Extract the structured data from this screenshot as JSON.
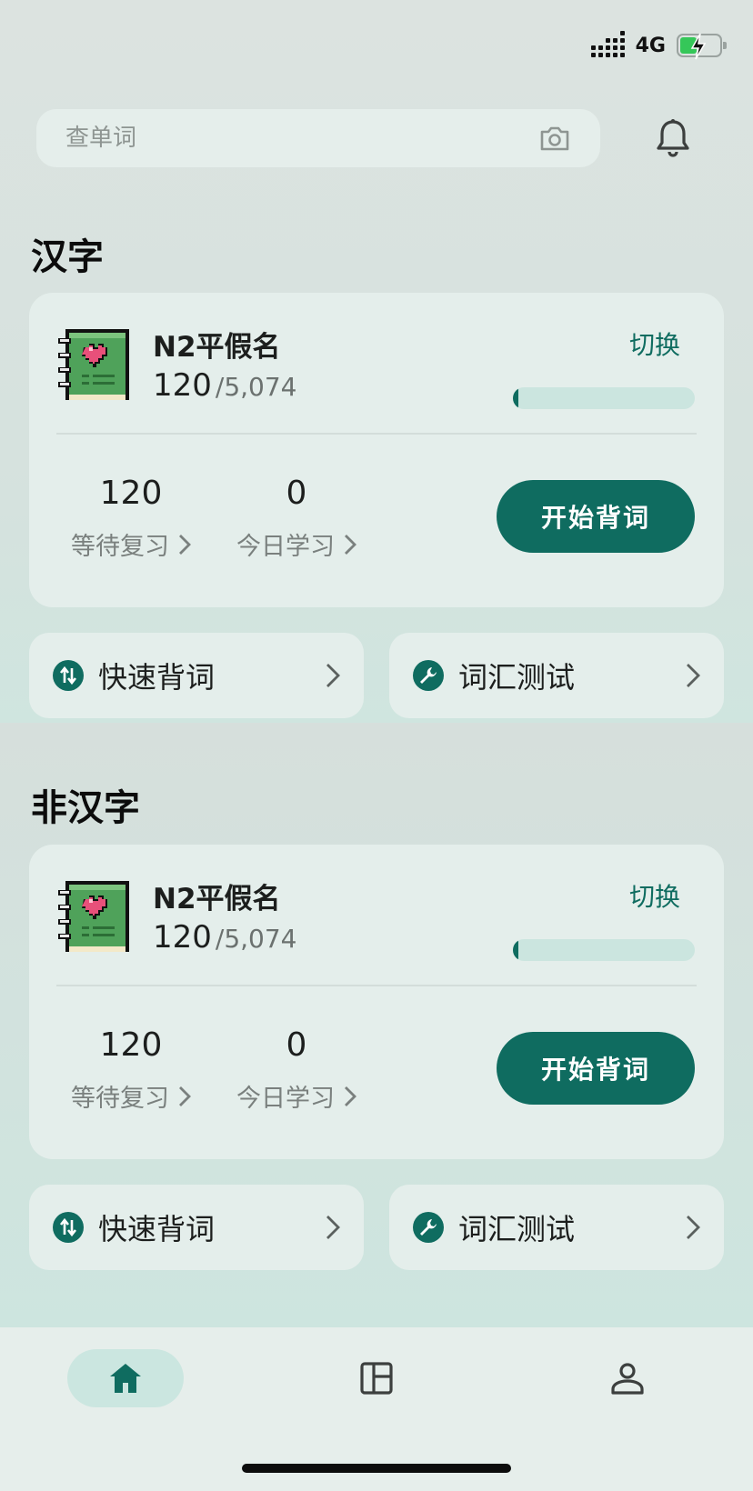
{
  "status_bar": {
    "network": "4G",
    "battery_level": 0.44,
    "icons": [
      "signal-icon",
      "battery-charging-icon"
    ]
  },
  "search": {
    "placeholder": "查单词",
    "icons": [
      "camera-icon"
    ]
  },
  "notifications": {
    "icon": "bell-icon"
  },
  "sections": [
    {
      "title": "汉字",
      "deck": {
        "name": "N2平假名",
        "learned": "120",
        "total": "/5,074",
        "switch_label": "切换",
        "progress": 0.024
      },
      "stats": [
        {
          "value": "120",
          "label": "等待复习"
        },
        {
          "value": "0",
          "label": "今日学习"
        }
      ],
      "start_label": "开始背词",
      "quick_actions": [
        {
          "label": "快速背词",
          "icon": "swap-vertical-icon"
        },
        {
          "label": "词汇测试",
          "icon": "wrench-icon"
        }
      ]
    },
    {
      "title": "非汉字",
      "deck": {
        "name": "N2平假名",
        "learned": "120",
        "total": "/5,074",
        "switch_label": "切换",
        "progress": 0.024
      },
      "stats": [
        {
          "value": "120",
          "label": "等待复习"
        },
        {
          "value": "0",
          "label": "今日学习"
        }
      ],
      "start_label": "开始背词",
      "quick_actions": [
        {
          "label": "快速背词",
          "icon": "swap-vertical-icon"
        },
        {
          "label": "词汇测试",
          "icon": "wrench-icon"
        }
      ]
    }
  ],
  "bottom_nav": [
    {
      "icon": "home-icon",
      "active": true
    },
    {
      "icon": "layout-icon",
      "active": false
    },
    {
      "icon": "person-icon",
      "active": false
    }
  ],
  "colors": {
    "accent": "#0f6c60",
    "card": "#e4eeeb",
    "progress_track": "#cbe5df"
  }
}
